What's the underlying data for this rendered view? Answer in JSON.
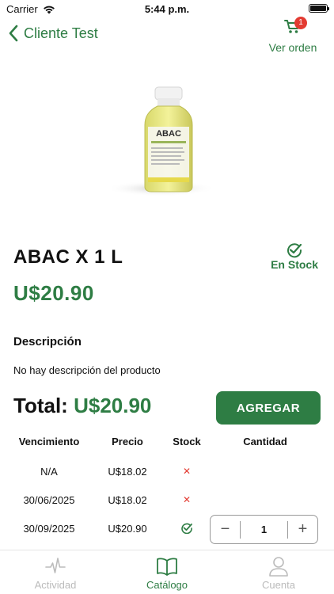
{
  "status_bar": {
    "carrier": "Carrier",
    "time": "5:44 p.m."
  },
  "nav": {
    "back_label": "Cliente Test",
    "cart_label": "Ver orden",
    "cart_count": "1",
    "accent": "#2e7d44",
    "badge_color": "#e33b32"
  },
  "product": {
    "image": {
      "bottle_label": "ABAC"
    },
    "name": "ABAC X 1 L",
    "stock_label": "En Stock",
    "price": "U$20.90",
    "description_title": "Descripción",
    "description_text": "No hay descripción del producto"
  },
  "total": {
    "label": "Total:",
    "value": "U$20.90"
  },
  "add_button": {
    "label": "AGREGAR"
  },
  "lots_table": {
    "headers": [
      "Vencimiento",
      "Precio",
      "Stock",
      "Cantidad"
    ],
    "rows": [
      {
        "expiry": "N/A",
        "price": "U$18.02",
        "stock": "x",
        "in_stock": false
      },
      {
        "expiry": "30/06/2025",
        "price": "U$18.02",
        "stock": "x",
        "in_stock": false
      },
      {
        "expiry": "30/09/2025",
        "price": "U$20.90",
        "stock": "check",
        "in_stock": true,
        "quantity": "1"
      }
    ]
  },
  "stepper": {
    "minus": "−",
    "plus": "+",
    "value": "1"
  },
  "tab_bar": {
    "tabs": [
      {
        "label": "Actividad",
        "icon": "activity-icon",
        "active": false
      },
      {
        "label": "Catálogo",
        "icon": "book-icon",
        "active": true
      },
      {
        "label": "Cuenta",
        "icon": "user-icon",
        "active": false
      }
    ]
  }
}
